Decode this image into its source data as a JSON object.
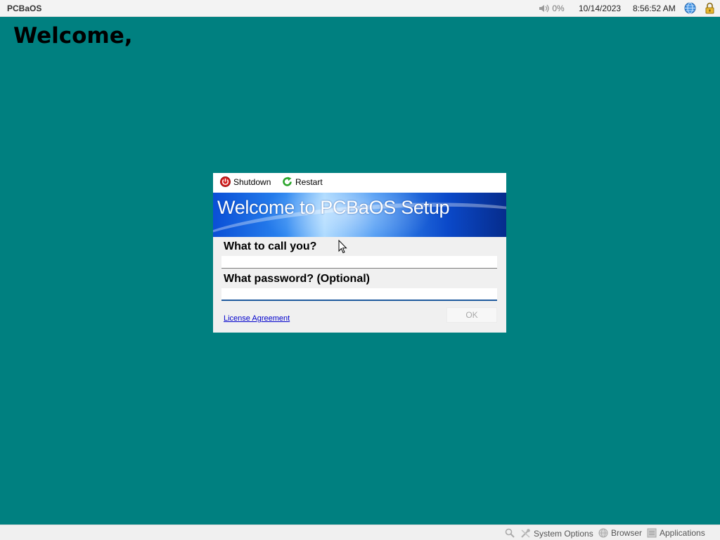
{
  "topbar": {
    "os_name": "PCBaOS",
    "volume": "0%",
    "date": "10/14/2023",
    "time": "8:56:52 AM",
    "icons": [
      "volume-icon",
      "globe-icon",
      "lock-icon"
    ]
  },
  "desktop": {
    "heading": "Welcome,"
  },
  "dialog": {
    "shutdown_label": "Shutdown",
    "restart_label": "Restart",
    "banner_title": "Welcome to PCBaOS Setup",
    "name_label": "What to call you?",
    "name_value": "",
    "password_label": "What password? (Optional)",
    "password_value": "",
    "license_link": "License Agreement",
    "ok_label": "OK"
  },
  "bottombar": {
    "system_options": "System Options",
    "browser": "Browser",
    "applications": "Applications"
  },
  "colors": {
    "desktop": "#008080",
    "shutdown_red": "#d42020",
    "restart_green": "#2aa52a",
    "link_blue": "#0000cc"
  }
}
